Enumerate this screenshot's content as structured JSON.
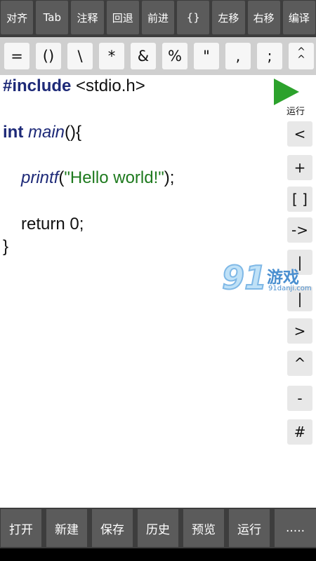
{
  "toolbar_top": [
    "对齐",
    "Tab",
    "注释",
    "回退",
    "前进",
    "{}",
    "左移",
    "右移",
    "编译"
  ],
  "symbols": [
    "=",
    "()",
    "\\",
    "*",
    "&",
    "%",
    "\"",
    ",",
    ";",
    "^\n^"
  ],
  "code": {
    "include": "#include",
    "header": " <stdio.h>",
    "type": "int",
    "func": "main",
    "func_tail": "(){",
    "call": "printf",
    "paren_open": "(",
    "string": "\"Hello world!\"",
    "paren_close": ");",
    "ret": "return 0;",
    "close": "}"
  },
  "run_button": {
    "label": "运行",
    "icon": "play-icon",
    "color": "#2ca22c"
  },
  "side_keys": [
    "<",
    "+",
    "[ ]",
    "->",
    "|",
    "|",
    ">",
    "^",
    "-",
    "#"
  ],
  "watermark": {
    "number": "91",
    "text": "游戏",
    "url": "91danji.com"
  },
  "toolbar_bottom": [
    "打开",
    "新建",
    "保存",
    "历史",
    "预览",
    "运行",
    "....."
  ]
}
